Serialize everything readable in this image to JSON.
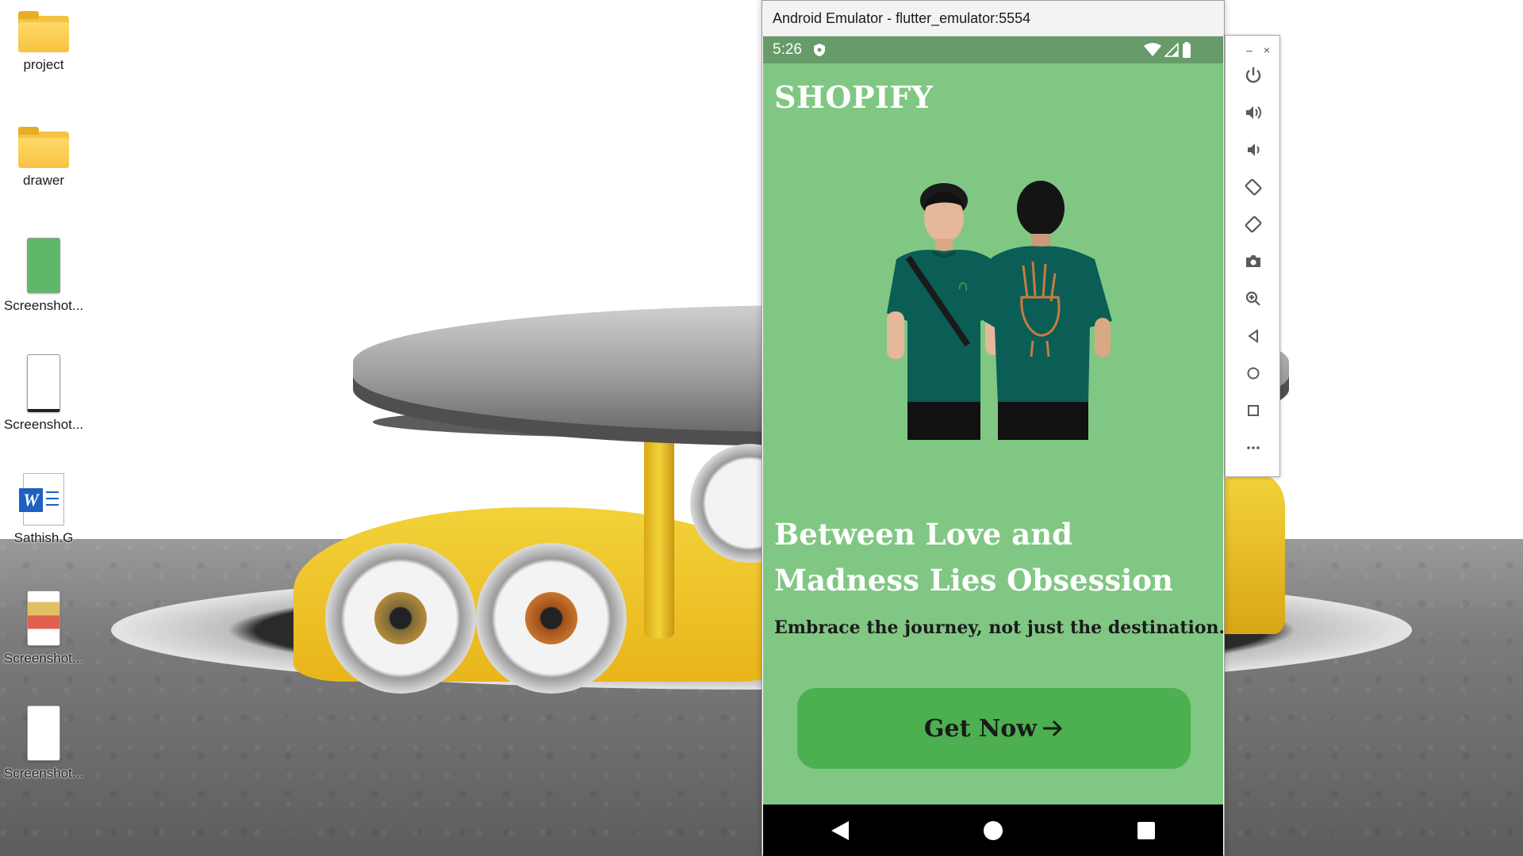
{
  "desktop": {
    "icons": [
      {
        "label": "project",
        "kind": "folder"
      },
      {
        "label": "drawer",
        "kind": "folder"
      },
      {
        "label": "Screenshot...",
        "kind": "image"
      },
      {
        "label": "Screenshot...",
        "kind": "image"
      },
      {
        "label": "Sathish.G",
        "kind": "word-document"
      },
      {
        "label": "Screenshot...",
        "kind": "image"
      },
      {
        "label": "Screenshot...",
        "kind": "image"
      }
    ]
  },
  "emulator": {
    "window_title": "Android Emulator - flutter_emulator:5554",
    "status_bar": {
      "time": "5:26",
      "icons": [
        "shield-icon",
        "wifi-icon",
        "signal-icon",
        "battery-icon"
      ]
    },
    "app": {
      "title": "SHOPIFY",
      "headline": "Between Love and Madness Lies Obsession",
      "tagline": "Embrace the journey, not just the destination.",
      "cta_label": "Get Now",
      "cta_icon": "arrow-right-icon"
    },
    "nav_bar": [
      "back-icon",
      "home-icon",
      "recents-icon"
    ],
    "toolbar": {
      "window_controls": [
        "–",
        "×"
      ],
      "tools": [
        "power-icon",
        "volume-up-icon",
        "volume-down-icon",
        "rotate-left-icon",
        "rotate-right-icon",
        "camera-icon",
        "zoom-icon",
        "back-icon",
        "home-icon",
        "overview-icon",
        "more-icon"
      ]
    }
  },
  "colors": {
    "app_background": "#81c784",
    "status_bar": "#679b69",
    "cta_button": "#4caf50",
    "shirt": "#0b5e55"
  }
}
